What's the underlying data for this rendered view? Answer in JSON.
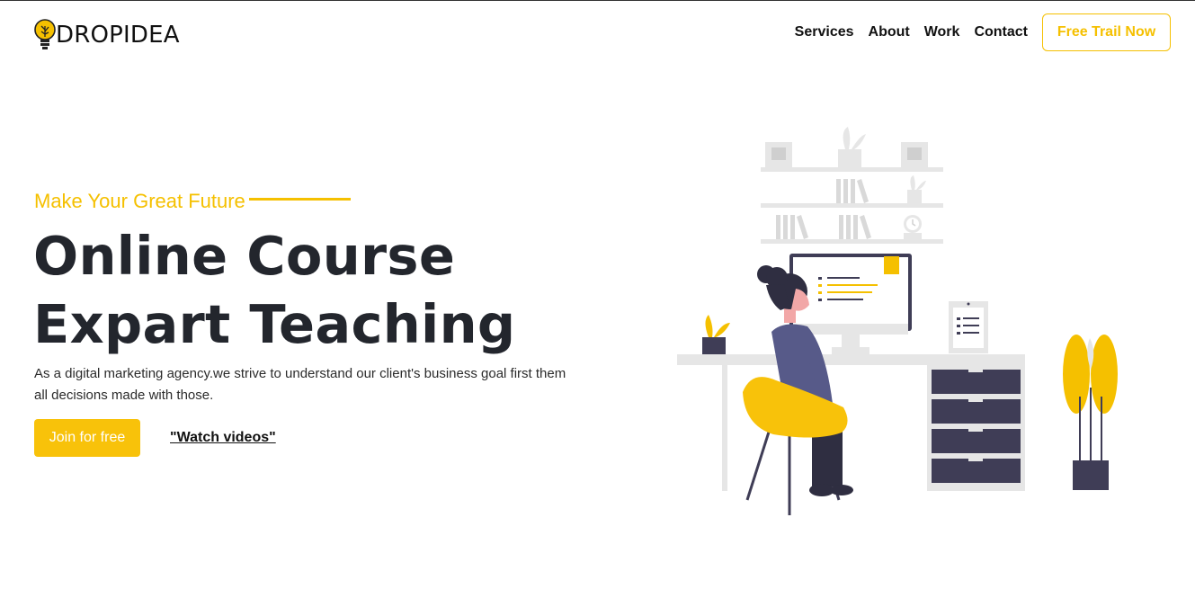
{
  "brand": {
    "name": "DROPIDEA",
    "icon": "lightbulb-icon",
    "accent": "#f5c000"
  },
  "nav": {
    "links": [
      "Services",
      "About",
      "Work",
      "Contact"
    ],
    "cta_label": "Free Trail Now"
  },
  "hero": {
    "tagline": "Make Your Great Future",
    "headline_line1": "Online Course",
    "headline_line2": "Expart Teaching",
    "description": "As a digital marketing agency.we strive to understand our client's business goal first them all decisions made with those.",
    "primary_button": "Join for free",
    "secondary_link": "\"Watch videos\""
  },
  "illustration": {
    "icon": "woman-at-desk-illustration"
  },
  "colors": {
    "accent": "#f5c000",
    "dark": "#3f3d56",
    "text": "#23262d"
  }
}
